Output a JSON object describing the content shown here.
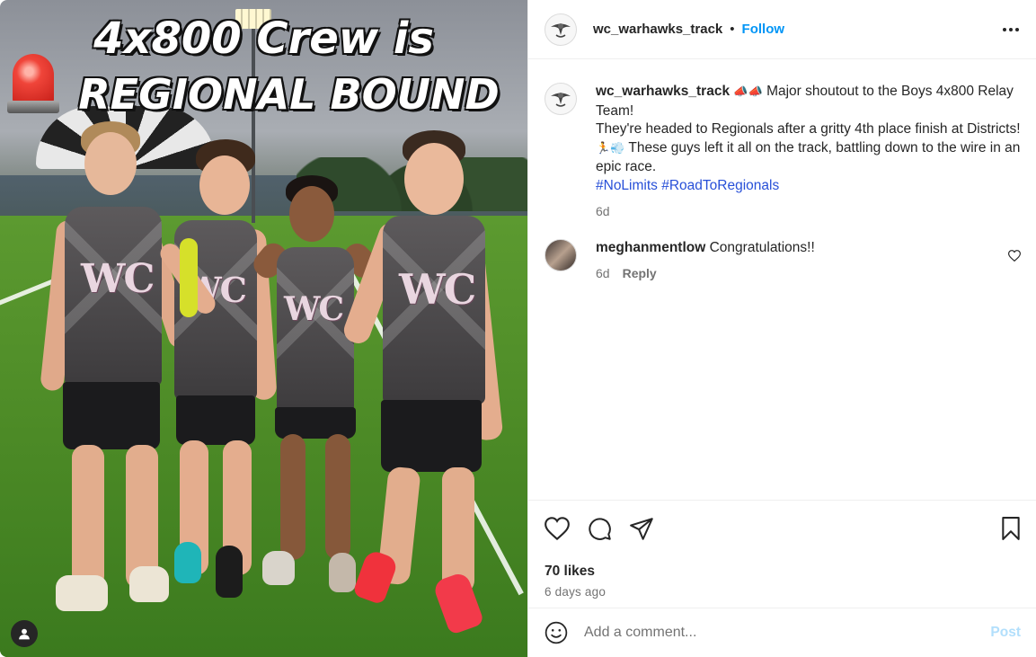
{
  "photo": {
    "headline_line1": "4x800 Crew is",
    "headline_line2": "REGIONAL BOUND",
    "jersey_text": "WC"
  },
  "header": {
    "username": "wc_warhawks_track",
    "separator": "•",
    "follow_label": "Follow"
  },
  "caption": {
    "username": "wc_warhawks_track",
    "emoji_1": "📣📣",
    "text_1": " Major shoutout to the Boys 4x800 Relay Team!",
    "text_2": "They're headed to Regionals after a gritty 4th place finish at Districts! ",
    "emoji_2": "🏃💨",
    "text_3": " These guys left it all on the track, battling down to the wire in an epic race.",
    "hashtag_1": "#NoLimits",
    "hashtag_2": "#RoadToRegionals",
    "time": "6d"
  },
  "comment": {
    "username": "meghanmentlow",
    "text": "Congratulations!!",
    "time": "6d",
    "reply_label": "Reply"
  },
  "stats": {
    "likes": "70 likes",
    "posted_ago": "6 days ago"
  },
  "composer": {
    "placeholder": "Add a comment...",
    "post_label": "Post"
  },
  "colors": {
    "follow": "#0095f6",
    "hashtag": "#2850d8",
    "post_disabled": "#b2dffc",
    "muted_text": "#737373"
  },
  "icons": [
    "more-icon",
    "heart-icon",
    "comment-icon",
    "share-icon",
    "bookmark-icon",
    "emoji-icon",
    "small-heart-icon",
    "user-tag-icon",
    "warhawk-logo",
    "siren-icon"
  ]
}
